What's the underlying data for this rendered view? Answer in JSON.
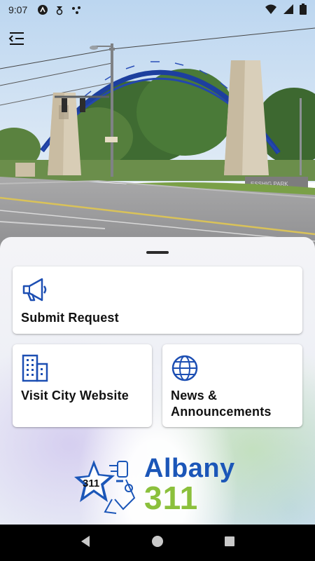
{
  "status_bar": {
    "time": "9:07",
    "left_icons": [
      "accessibility-icon",
      "location-icon",
      "dots-icon"
    ],
    "right_icons": [
      "wifi-icon",
      "signal-icon",
      "battery-icon"
    ]
  },
  "header": {
    "menu_icon": "menu-open-icon"
  },
  "hero": {
    "sign_text": "ESSHIG PARK"
  },
  "actions": {
    "submit": {
      "label": "Submit Request",
      "icon": "megaphone-icon"
    },
    "city": {
      "label": "Visit City Website",
      "icon": "city-buildings-icon"
    },
    "news": {
      "label_line1": "News &",
      "label_line2": "Announcements",
      "icon": "globe-icon"
    }
  },
  "logo": {
    "city": "Albany",
    "number": "311",
    "badge": "311"
  },
  "colors": {
    "brand_blue": "#1b56b8",
    "brand_green": "#8bc03c",
    "icon_blue": "#1d4fb3"
  },
  "nav_bar": {
    "buttons": [
      "back-icon",
      "home-icon",
      "recents-icon"
    ]
  }
}
